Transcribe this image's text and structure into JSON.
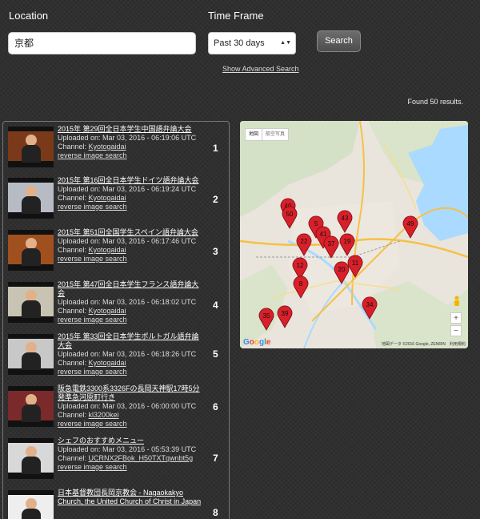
{
  "form": {
    "location_label": "Location",
    "location_value": "京都",
    "timeframe_label": "Time Frame",
    "timeframe_value": "Past 30 days",
    "search_label": "Search",
    "advanced_link": "Show Advanced Search"
  },
  "found_text": "Found 50 results.",
  "results": [
    {
      "num": "1",
      "title": "2015年 第29回全日本学生中国語弁論大会",
      "uploaded": "Uploaded on: Mar 03, 2016 - 06:19:06 UTC",
      "channel_prefix": "Channel:",
      "channel": "Kyotogaidai",
      "reverse": "reverse image search",
      "thumb": "#7a3a1a"
    },
    {
      "num": "2",
      "title": "2015年 第16回全日本学生ドイツ語弁論大会",
      "uploaded": "Uploaded on: Mar 03, 2016 - 06:19:24 UTC",
      "channel_prefix": "Channel:",
      "channel": "Kyotogaidai",
      "reverse": "reverse image search",
      "thumb": "#b7bcc4"
    },
    {
      "num": "3",
      "title": "2015年 第51回全国学生スペイン語弁論大会",
      "uploaded": "Uploaded on: Mar 03, 2016 - 06:17:46 UTC",
      "channel_prefix": "Channel:",
      "channel": "Kyotogaidai",
      "reverse": "reverse image search",
      "thumb": "#a0501e"
    },
    {
      "num": "4",
      "title": "2015年 第47回全日本学生フランス語弁論大会",
      "uploaded": "Uploaded on: Mar 03, 2016 - 06:18:02 UTC",
      "channel_prefix": "Channel:",
      "channel": "Kyotogaidai",
      "reverse": "reverse image search",
      "thumb": "#c9c3b3"
    },
    {
      "num": "5",
      "title": "2015年 第33回全日本学生ポルトガル語弁論大会",
      "uploaded": "Uploaded on: Mar 03, 2016 - 06:18:26 UTC",
      "channel_prefix": "Channel:",
      "channel": "Kyotogaidai",
      "reverse": "reverse image search",
      "thumb": "#c8c8c8"
    },
    {
      "num": "6",
      "title": "阪急電鉄3300系3326Fの長岡天神駅17時5分発準急河原町行き",
      "uploaded": "Uploaded on: Mar 03, 2016 - 06:00:00 UTC",
      "channel_prefix": "Channel:",
      "channel": "kl3200kei",
      "reverse": "reverse image search",
      "thumb": "#7a2a2a"
    },
    {
      "num": "7",
      "title": "シェフのおすすめメニュー",
      "uploaded": "Uploaded on: Mar 03, 2016 - 05:53:39 UTC",
      "channel_prefix": "Channel:",
      "channel": "UCRNX2FBok_H50TXTqwnbt5g",
      "reverse": "reverse image search",
      "thumb": "#d8d8d8"
    },
    {
      "num": "8",
      "title": "日本基督教団長岡京教会 - Nagaokakyo Church, the United Church of Christ in Japan",
      "uploaded": "",
      "channel_prefix": "",
      "channel": "",
      "reverse": "",
      "thumb": "#eeeeee"
    }
  ],
  "map": {
    "map_type_label": "地図",
    "satellite_label": "航空写真",
    "google_logo": "Google",
    "attribution": "地図データ ©2016 Google, ZENRIN　利用規約",
    "zoom_in": "+",
    "zoom_out": "−",
    "markers": [
      "49",
      "40",
      "50",
      "5",
      "43",
      "41",
      "37",
      "19",
      "22",
      "12",
      "20",
      "11",
      "8",
      "34",
      "39",
      "35"
    ]
  }
}
